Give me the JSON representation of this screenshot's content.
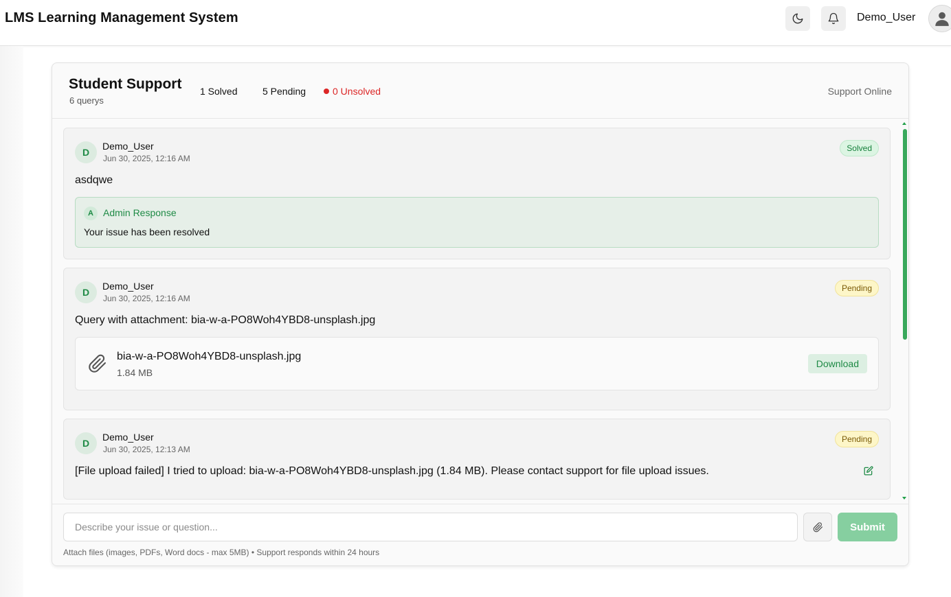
{
  "app": {
    "title": "LMS Learning Management System"
  },
  "topbar": {
    "username": "Demo_User",
    "theme_icon": "moon-icon",
    "bell_icon": "bell-icon",
    "avatar_icon": "user-icon"
  },
  "support": {
    "title": "Student Support",
    "count_label": "6 querys",
    "solved_label": "1 Solved",
    "pending_label": "5 Pending",
    "unsolved_label": "0 Unsolved",
    "status_label": "Support Online"
  },
  "messages": [
    {
      "initial": "D",
      "user": "Demo_User",
      "time": "Jun 30, 2025, 12:16 AM",
      "status": "Solved",
      "text": "asdqwe",
      "admin": {
        "initial": "A",
        "label": "Admin Response",
        "text": "Your issue has been resolved"
      }
    },
    {
      "initial": "D",
      "user": "Demo_User",
      "time": "Jun 30, 2025, 12:16 AM",
      "status": "Pending",
      "text": "Query with attachment: bia-w-a-PO8Woh4YBD8-unsplash.jpg",
      "attachment": {
        "name": "bia-w-a-PO8Woh4YBD8-unsplash.jpg",
        "size": "1.84 MB",
        "download_label": "Download"
      }
    },
    {
      "initial": "D",
      "user": "Demo_User",
      "time": "Jun 30, 2025, 12:13 AM",
      "status": "Pending",
      "text": "[File upload failed] I tried to upload: bia-w-a-PO8Woh4YBD8-unsplash.jpg (1.84 MB). Please contact support for file upload issues."
    }
  ],
  "composer": {
    "placeholder": "Describe your issue or question...",
    "submit_label": "Submit",
    "hint": "Attach files (images, PDFs, Word docs - max 5MB) • Support responds within 24 hours"
  },
  "colors": {
    "accent": "#22a04a",
    "solved_badge": "#dcf5e3",
    "pending_badge": "#fdf6c8",
    "unsolved": "#dc2626",
    "submit": "#86cfa0"
  }
}
